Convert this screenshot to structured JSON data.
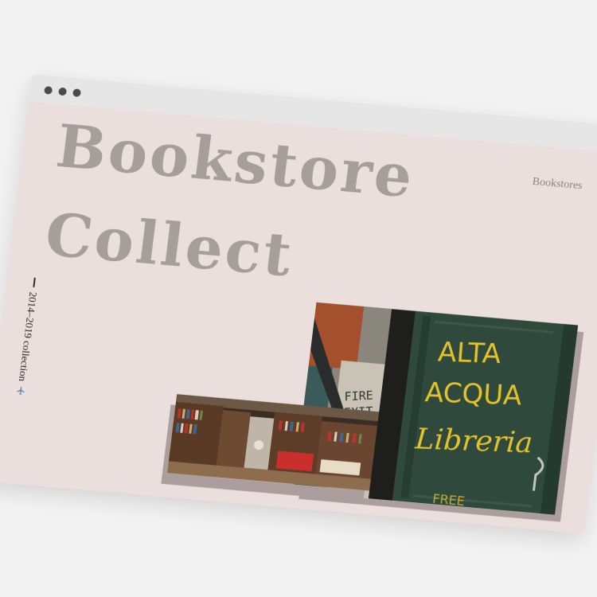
{
  "window": {
    "controls": [
      "dot",
      "dot",
      "dot"
    ]
  },
  "hero": {
    "title_line1": "Bookstore",
    "title_line2": "Collect"
  },
  "nav": {
    "bookstores_link": "Bookstores"
  },
  "sidebar": {
    "collection_label": "2014–2019 collection",
    "icon": "airplane-icon"
  },
  "photos": {
    "door_sign": {
      "fire_exit_line1": "FIRE",
      "fire_exit_line2": "EXIT",
      "alta": "ALTA",
      "acqua": "ACQUA",
      "libreria": "Libreria",
      "free": "FREE"
    }
  },
  "colors": {
    "page_background": "#eadfdd",
    "title_text": "#a59e9b",
    "titlebar": "#e6e6e6",
    "door_green": "#2f4a3c",
    "sign_yellow": "#e4c229",
    "photo_shadow": "#ab9e9d"
  }
}
